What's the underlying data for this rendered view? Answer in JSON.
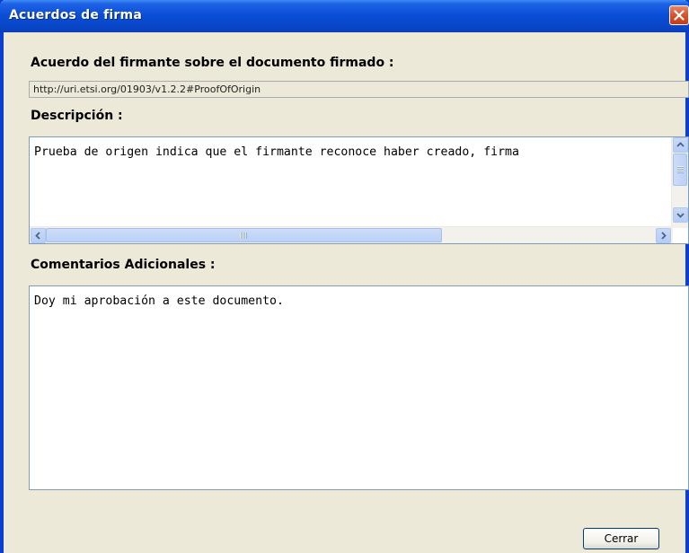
{
  "window": {
    "title": "Acuerdos de firma"
  },
  "agreement": {
    "label": "Acuerdo del firmante sobre el documento firmado :",
    "value": "http://uri.etsi.org/01903/v1.2.2#ProofOfOrigin"
  },
  "description": {
    "label": "Descripción :",
    "text": "Prueba de origen indica que el firmante reconoce haber creado, firma"
  },
  "comments": {
    "label": "Comentarios Adicionales :",
    "text": "Doy mi aprobación a este documento."
  },
  "footer": {
    "close_label": "Cerrar"
  },
  "colors": {
    "titlebar": "#0a4fd6",
    "close_button": "#d6532e",
    "dialog_bg": "#ece9d8"
  },
  "icons": [
    "close-icon",
    "arrow-up-icon",
    "arrow-down-icon",
    "arrow-left-icon",
    "arrow-right-icon"
  ]
}
